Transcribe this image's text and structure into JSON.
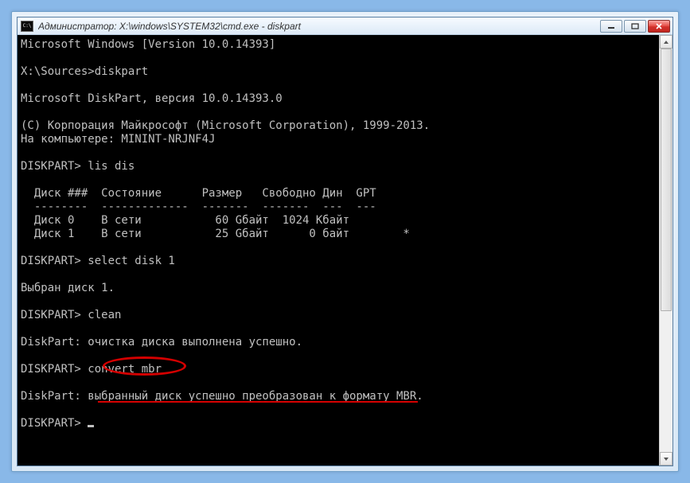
{
  "titlebar": {
    "title": "Администратор: X:\\windows\\SYSTEM32\\cmd.exe - diskpart"
  },
  "console": {
    "lines": [
      "Microsoft Windows [Version 10.0.14393]",
      "",
      "X:\\Sources>diskpart",
      "",
      "Microsoft DiskPart, версия 10.0.14393.0",
      "",
      "(C) Корпорация Майкрософт (Microsoft Corporation), 1999-2013.",
      "На компьютере: MININT-NRJNF4J",
      "",
      "DISKPART> lis dis",
      "",
      "  Диск ###  Состояние      Размер   Свободно Дин  GPT",
      "  --------  -------------  -------  -------  ---  ---",
      "  Диск 0    В сети           60 Gбайт  1024 Kбайт",
      "  Диск 1    В сети           25 Gбайт      0 байт        *",
      "",
      "DISKPART> select disk 1",
      "",
      "Выбран диск 1.",
      "",
      "DISKPART> clean",
      "",
      "DiskPart: очистка диска выполнена успешно.",
      "",
      "DISKPART> convert mbr",
      "",
      "DiskPart: выбранный диск успешно преобразован к формату MBR.",
      "",
      "DISKPART> "
    ]
  }
}
